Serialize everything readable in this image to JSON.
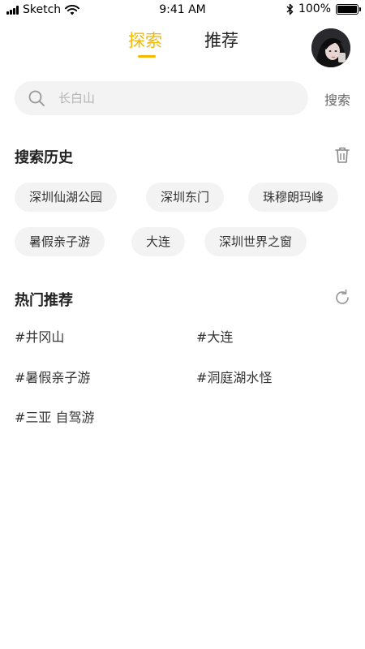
{
  "status_bar": {
    "carrier": "Sketch",
    "time": "9:41 AM",
    "battery": "100%"
  },
  "tabs": [
    {
      "label": "探索",
      "active": true
    },
    {
      "label": "推荐",
      "active": false
    }
  ],
  "search": {
    "placeholder": "长白山",
    "button_label": "搜索"
  },
  "history": {
    "title": "搜索历史",
    "items": [
      "深圳仙湖公园",
      "深圳东门",
      "珠穆朗玛峰",
      "暑假亲子游",
      "大连",
      "深圳世界之窗"
    ]
  },
  "hot": {
    "title": "热门推荐",
    "items": [
      "#井冈山",
      "#大连",
      "#暑假亲子游",
      "#洞庭湖水怪",
      "#三亚 自驾游"
    ]
  },
  "colors": {
    "accent": "#F5B800",
    "chip_bg": "#f3f3f3"
  },
  "icons": [
    "signal-icon",
    "wifi-icon",
    "bluetooth-icon",
    "battery-icon",
    "search-icon",
    "trash-icon",
    "refresh-icon"
  ]
}
